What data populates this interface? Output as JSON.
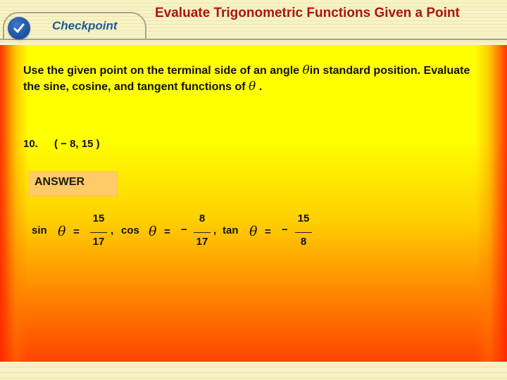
{
  "header": {
    "tab_label": "Checkpoint",
    "tab_icon": "checkmark-icon",
    "title": "Evaluate Trigonometric Functions Given a Point",
    "accent_color": "#b0140c",
    "tab_text_color": "#1d5a94"
  },
  "instructions": {
    "part1": "Use the given point on the terminal side of an angle ",
    "symbol": "θ",
    "part2": "in standard position. Evaluate the sine, cosine, and tangent functions of ",
    "part3": " ."
  },
  "problem": {
    "number": "10.",
    "point": "( − 8,  15 )"
  },
  "answer": {
    "label": "ANSWER",
    "sin": {
      "label": "sin",
      "symbol": "θ",
      "equals": "=",
      "sign": "",
      "numerator": "15",
      "denominator": "17"
    },
    "cos": {
      "label": "cos",
      "symbol": "θ",
      "equals": "=",
      "sign": "−",
      "numerator": "8",
      "denominator": "17"
    },
    "tan": {
      "label": "tan",
      "symbol": "θ",
      "equals": "=",
      "sign": "−",
      "numerator": "15",
      "denominator": "8"
    },
    "separator": ","
  }
}
